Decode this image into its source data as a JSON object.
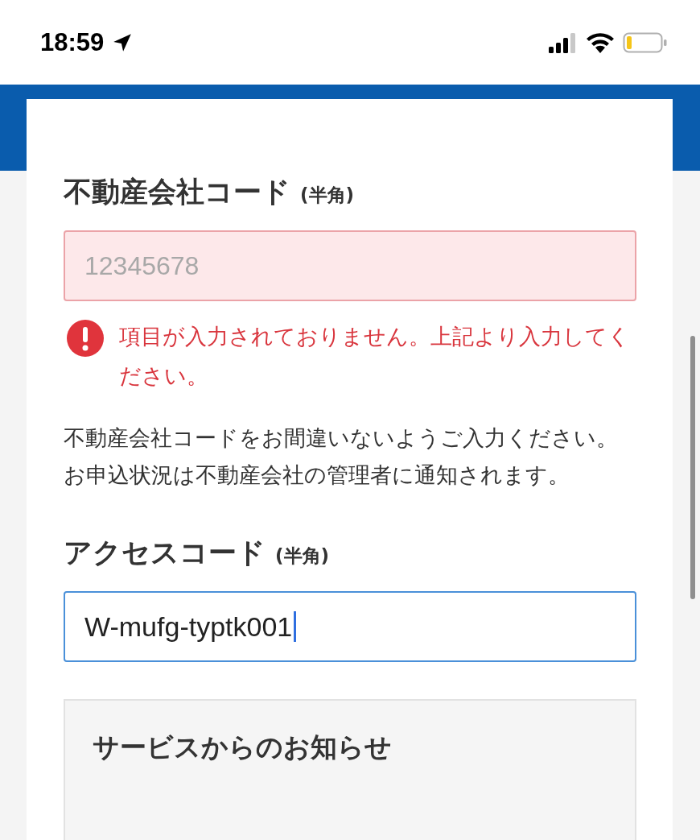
{
  "status_bar": {
    "time": "18:59"
  },
  "fields": [
    {
      "label": "不動産会社コード",
      "note": "(半角)",
      "placeholder": "12345678",
      "error": true,
      "focused": false,
      "error_message": "項目が入力されておりません。上記より入力してください。",
      "help": "不動産会社コードをお間違いないようご入力ください。お申込状況は不動産会社の管理者に通知されます。"
    },
    {
      "label": "アクセスコード",
      "note": "(半角)",
      "value": "W-mufg-typtk001",
      "error": false,
      "focused": true
    }
  ],
  "notice": {
    "title": "サービスからのお知らせ"
  }
}
